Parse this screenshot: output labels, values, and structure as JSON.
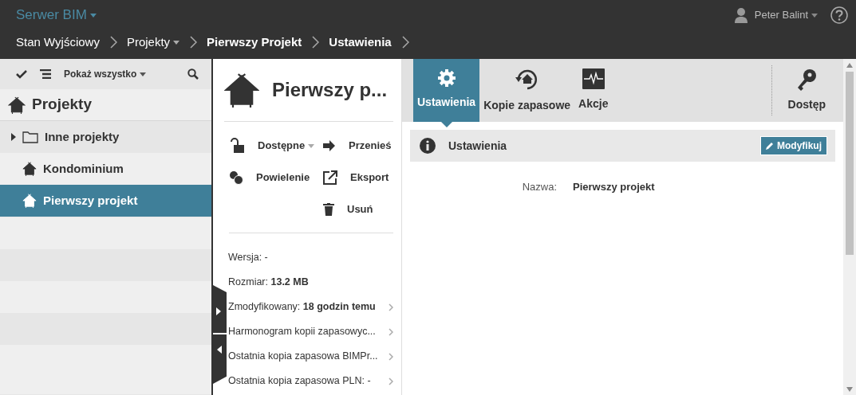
{
  "app_title": "Serwer BIM",
  "user": {
    "name": "Peter Balint"
  },
  "breadcrumbs": [
    {
      "label": "Stan Wyjściowy",
      "bold": false,
      "dropdown": false
    },
    {
      "label": "Projekty",
      "bold": false,
      "dropdown": true
    },
    {
      "label": "Pierwszy Projekt",
      "bold": true,
      "dropdown": false
    },
    {
      "label": "Ustawienia",
      "bold": true,
      "dropdown": false
    }
  ],
  "sidebar": {
    "filter": "Pokaż wszystko",
    "title": "Projekty",
    "items": [
      {
        "label": "Inne projekty",
        "kind": "folder",
        "selected": false
      },
      {
        "label": "Kondominium",
        "kind": "project",
        "selected": false
      },
      {
        "label": "Pierwszy projekt",
        "kind": "project",
        "selected": true
      }
    ]
  },
  "project": {
    "title": "Pierwszy p...",
    "actions": [
      {
        "label": "Dostępne",
        "dropdown": true
      },
      {
        "label": "Przenieś",
        "dropdown": false
      },
      {
        "label": "Powielenie",
        "dropdown": false
      },
      {
        "label": "Eksport",
        "dropdown": false
      },
      {
        "label": "Usuń",
        "dropdown": false
      }
    ],
    "details": [
      {
        "text": "Wersja: -",
        "more": false
      },
      {
        "text": "Rozmiar: **13.2 MB**",
        "more": false
      },
      {
        "text": "Zmodyfikowany: **18 godzin temu**",
        "more": true
      },
      {
        "text": "Harmonogram kopii zapasowyc...",
        "more": true
      },
      {
        "text": "Ostatnia kopia zapasowa BIMPr...",
        "more": true
      },
      {
        "text": "Ostatnia kopia zapasowa PLN: -",
        "more": true
      }
    ]
  },
  "tabs": [
    {
      "label": "Ustawienia",
      "selected": true
    },
    {
      "label": "Kopie zapasowe",
      "selected": false
    },
    {
      "label": "Akcje",
      "selected": false
    },
    {
      "label": "Dostęp",
      "selected": false
    }
  ],
  "section": {
    "title": "Ustawienia",
    "button": "Modyfikuj",
    "fields": [
      {
        "label": "Nazwa:",
        "value": "Pierwszy projekt"
      }
    ]
  }
}
